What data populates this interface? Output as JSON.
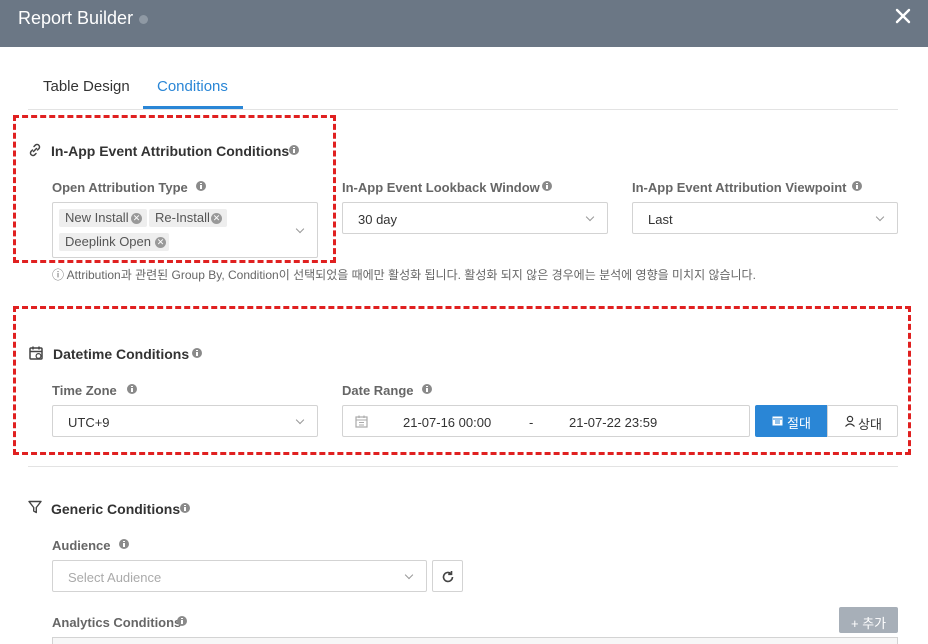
{
  "window": {
    "title": "Report Builder"
  },
  "tabs": [
    {
      "label": "Table Design"
    },
    {
      "label": "Conditions",
      "active": true
    }
  ],
  "attribution": {
    "title": "In-App Event Attribution Conditions",
    "open_type": {
      "label": "Open Attribution Type",
      "chips": [
        "New Install",
        "Re-Install",
        "Deeplink Open"
      ]
    },
    "lookback": {
      "label": "In-App Event Lookback Window",
      "value": "30 day"
    },
    "viewpoint": {
      "label": "In-App Event Attribution Viewpoint",
      "value": "Last"
    },
    "note": "ⓘ Attribution과 관련된 Group By, Condition이 선택되었을 때에만 활성화 됩니다. 활성화 되지 않은 경우에는 분석에 영향을 미치지 않습니다."
  },
  "datetime": {
    "title": "Datetime Conditions",
    "timezone": {
      "label": "Time Zone",
      "value": "UTC+9"
    },
    "range": {
      "label": "Date Range",
      "start": "21-07-16 00:00",
      "sep": "-",
      "end": "21-07-22 23:59"
    },
    "absolute_label": "절대",
    "relative_label": "상대"
  },
  "generic": {
    "title": "Generic Conditions",
    "audience": {
      "label": "Audience",
      "placeholder": "Select Audience"
    },
    "analytics": {
      "label": "Analytics Conditions",
      "add_label": "+ 추가"
    }
  },
  "colors": {
    "titlebar": "#6b7785",
    "accent": "#2a86d6",
    "highlight": "#e02020"
  },
  "icons": [
    "close-icon",
    "link-icon",
    "calendar-icon",
    "filter-icon",
    "info-icon",
    "refresh-icon",
    "user-icon",
    "chevron-down-icon"
  ]
}
